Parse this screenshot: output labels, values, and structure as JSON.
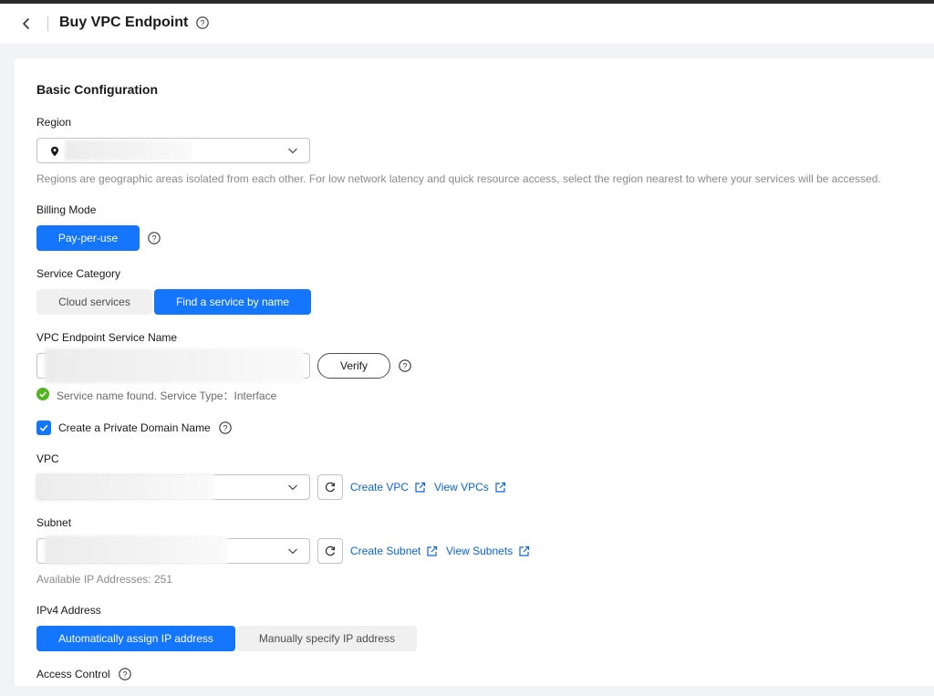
{
  "header": {
    "title": "Buy VPC Endpoint"
  },
  "section": {
    "title": "Basic Configuration"
  },
  "region": {
    "label": "Region",
    "hint": "Regions are geographic areas isolated from each other. For low network latency and quick resource access, select the region nearest to where your services will be accessed."
  },
  "billing": {
    "label": "Billing Mode",
    "option": "Pay-per-use"
  },
  "service_category": {
    "label": "Service Category",
    "options": [
      "Cloud services",
      "Find a service by name"
    ],
    "selected": "Find a service by name"
  },
  "endpoint_service": {
    "label": "VPC Endpoint Service Name",
    "verify_label": "Verify",
    "status": "Service name found. Service Type：Interface",
    "status_color": "#52b41e"
  },
  "private_domain": {
    "label": "Create a Private Domain Name",
    "checked": true
  },
  "vpc": {
    "label": "VPC",
    "create_link": "Create VPC",
    "view_link": "View VPCs"
  },
  "subnet": {
    "label": "Subnet",
    "create_link": "Create Subnet",
    "view_link": "View Subnets",
    "available": "Available IP Addresses: 251"
  },
  "ipv4": {
    "label": "IPv4 Address",
    "options": [
      "Automatically assign IP address",
      "Manually specify IP address"
    ],
    "selected": "Automatically assign IP address"
  },
  "access_control": {
    "label": "Access Control"
  },
  "colors": {
    "primary": "#1476ff",
    "link": "#0a66d6",
    "success": "#52b41e"
  }
}
